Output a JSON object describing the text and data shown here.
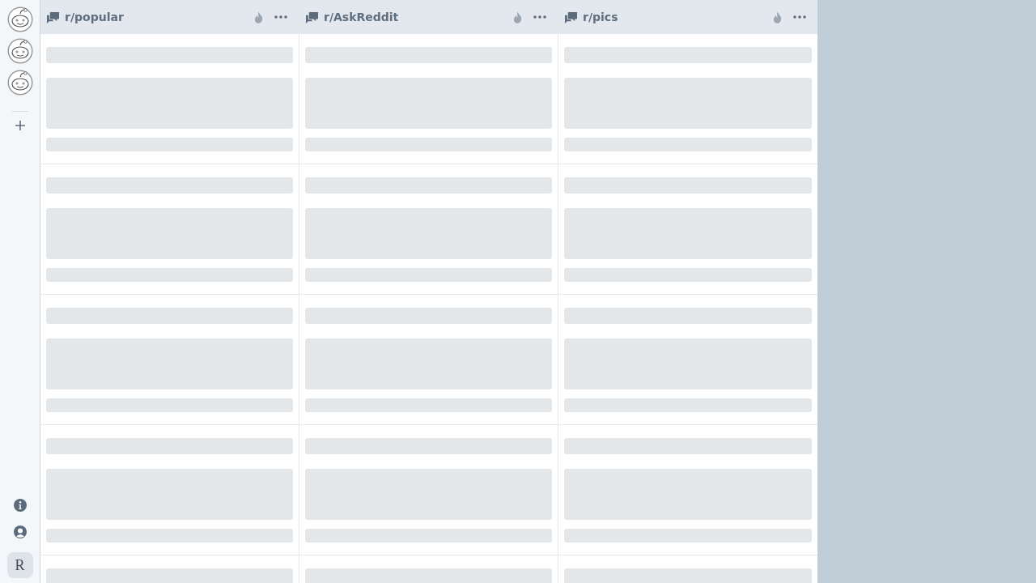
{
  "sidebar": {
    "accounts": [
      {
        "selected": false
      },
      {
        "selected": false
      },
      {
        "selected": false
      }
    ],
    "footer_button": "R"
  },
  "columns": [
    {
      "title": "r/popular",
      "loading": true
    },
    {
      "title": "r/AskReddit",
      "loading": true
    },
    {
      "title": "r/pics",
      "loading": true
    }
  ]
}
